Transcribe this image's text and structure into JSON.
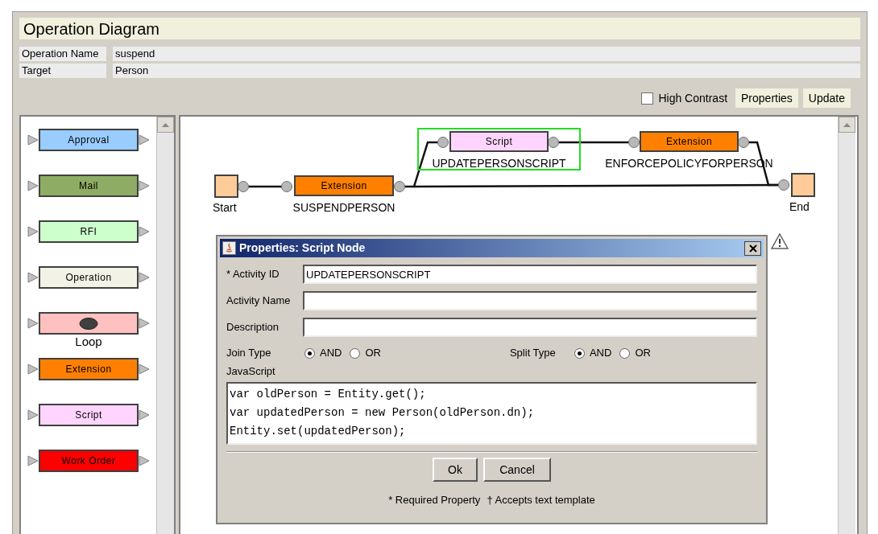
{
  "header": {
    "title": "Operation Diagram"
  },
  "fields": [
    {
      "label": "Operation Name",
      "value": "suspend"
    },
    {
      "label": "Target",
      "value": "Person"
    }
  ],
  "toolbar": {
    "high_contrast": {
      "label": "High Contrast",
      "checked": false
    },
    "buttons": [
      "Properties",
      "Update"
    ]
  },
  "palette": [
    {
      "kind": "node",
      "label": "Approval",
      "color": "#99ccff"
    },
    {
      "kind": "node",
      "label": "Mail",
      "color": "#8fac64"
    },
    {
      "kind": "node",
      "label": "RFI",
      "color": "#ccffcc"
    },
    {
      "kind": "node",
      "label": "Operation",
      "color": "#f2f2e6"
    },
    {
      "kind": "loop",
      "label": "Loop",
      "color": "#ffc0c0"
    },
    {
      "kind": "node",
      "label": "Extension",
      "color": "#ff8000"
    },
    {
      "kind": "node",
      "label": "Script",
      "color": "#ffd5ff"
    },
    {
      "kind": "node",
      "label": "Work Order",
      "color": "#ff0000"
    }
  ],
  "diagram": {
    "nodes": [
      {
        "kind": "terminal",
        "name": "Start",
        "selected": false
      },
      {
        "kind": "activity",
        "label": "Extension",
        "name": "SUSPENDPERSON",
        "color": "#ff8000",
        "selected": false
      },
      {
        "kind": "activity",
        "label": "Script",
        "name": "UPDATEPERSONSCRIPT",
        "color": "#ffd5ff",
        "selected": true
      },
      {
        "kind": "activity",
        "label": "Extension",
        "name": "ENFORCEPOLICYFORPERSON",
        "color": "#ff8000",
        "selected": false
      },
      {
        "kind": "terminal",
        "name": "End",
        "selected": false
      }
    ]
  },
  "dialog": {
    "title": "Properties: Script Node",
    "fields": [
      {
        "label": "* Activity ID",
        "value": "UPDATEPERSONSCRIPT"
      },
      {
        "label": "Activity Name"
      },
      {
        "label": "Description"
      }
    ],
    "join_type": {
      "label": "Join Type",
      "options": [
        {
          "label": "AND",
          "selected": true
        },
        {
          "label": "OR",
          "selected": false
        }
      ]
    },
    "split_type": {
      "label": "Split Type",
      "options": [
        {
          "label": "AND",
          "selected": true
        },
        {
          "label": "OR",
          "selected": false
        }
      ]
    },
    "script_label": "JavaScript",
    "script": [
      "var oldPerson = Entity.get();",
      "var updatedPerson = new Person(oldPerson.dn);",
      "Entity.set(updatedPerson);"
    ],
    "buttons": [
      "Ok",
      "Cancel"
    ],
    "footnotes": [
      "* Required Property",
      "† Accepts text template"
    ]
  }
}
